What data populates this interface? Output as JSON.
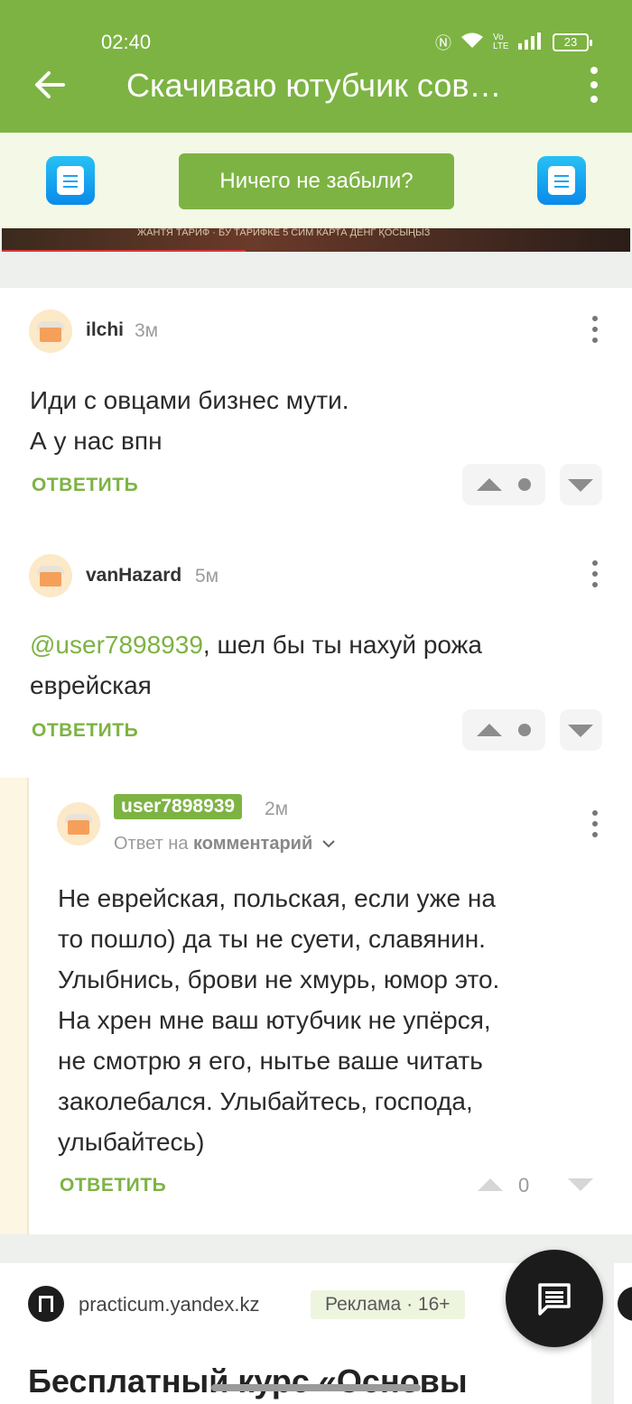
{
  "status_bar": {
    "time": "02:40",
    "battery": "23",
    "network": "Vo LTE"
  },
  "header": {
    "title": "Скачиваю ютубчик сов…"
  },
  "reminder": {
    "button_label": "Ничего не забыли?"
  },
  "banner": {
    "text": "ЖАНТЯ ТАРИФ · БУ ТАРИФКЕ 5 СИМ КАРТА ДЕНГ ҚОСЫҢЫЗ"
  },
  "comments": [
    {
      "username": "ilchi",
      "time": "3м",
      "lines": [
        "Иди с овцами бизнес мути.",
        "А у нас впн"
      ],
      "reply_label": "ОТВЕТИТЬ"
    },
    {
      "username": "vanHazard",
      "time": "5м",
      "mention": "@user7898939",
      "text_after_mention": ", шел бы ты нахуй рожа",
      "line2": "еврейская",
      "reply_label": "ОТВЕТИТЬ"
    },
    {
      "username": "user7898939",
      "time": "2м",
      "reply_prefix": "Ответ на",
      "reply_target": "комментарий",
      "lines": [
        "Не еврейская, польская, если уже на",
        "то пошло) да ты не суети, славянин.",
        "Улыбнись, брови не хмурь, юмор это.",
        "На хрен мне ваш ютубчик не упёрся,",
        "не смотрю я его, нытье ваше читать",
        "заколебался. Улыбайтесь, господа,",
        "улыбайтесь)"
      ],
      "reply_label": "ОТВЕТИТЬ",
      "rating": "0"
    }
  ],
  "ad": {
    "domain": "practicum.yandex.kz",
    "badge": "Реклама · 16+",
    "headline": "Бесплатный курс «Основы"
  },
  "colors": {
    "brand_green": "#7db343",
    "reminder_bg": "#f3f9e6",
    "nested_rail": "#fcf6e2"
  }
}
